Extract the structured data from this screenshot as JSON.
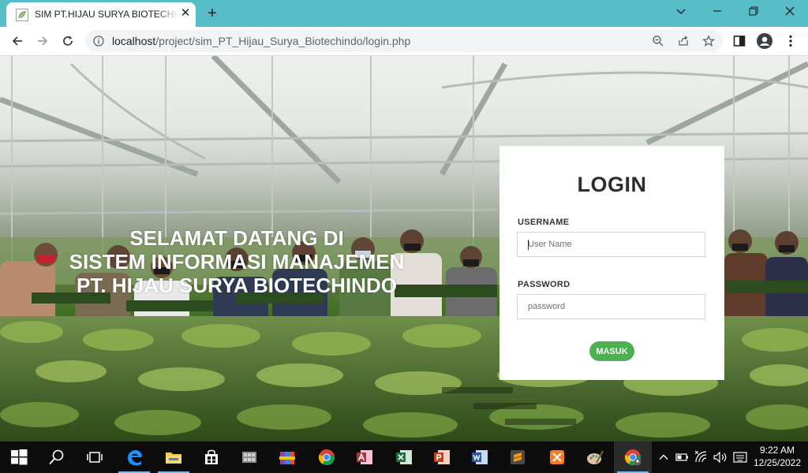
{
  "browser": {
    "tab_title": "SIM PT.HIJAU SURYA BIOTECHINDO",
    "tab_close": "✕",
    "new_tab": "+",
    "url_host": "localhost",
    "url_path": "/project/sim_PT_Hijau_Surya_Biotechindo/login.php"
  },
  "hero": {
    "line1": "SELAMAT DATANG DI",
    "line2": "SISTEM INFORMASI MANAJEMEN",
    "line3": "PT. HIJAU SURYA BIOTECHINDO"
  },
  "login": {
    "title": "LOGIN",
    "username_label": "USERNAME",
    "username_placeholder": "User Name",
    "password_label": "PASSWORD",
    "password_placeholder": "password",
    "submit_label": "MASUK"
  },
  "taskbar": {
    "time": "9:22 AM",
    "date": "12/25/2022"
  },
  "colors": {
    "titlebar": "#56bcc6",
    "submit_button": "#4caf50"
  }
}
